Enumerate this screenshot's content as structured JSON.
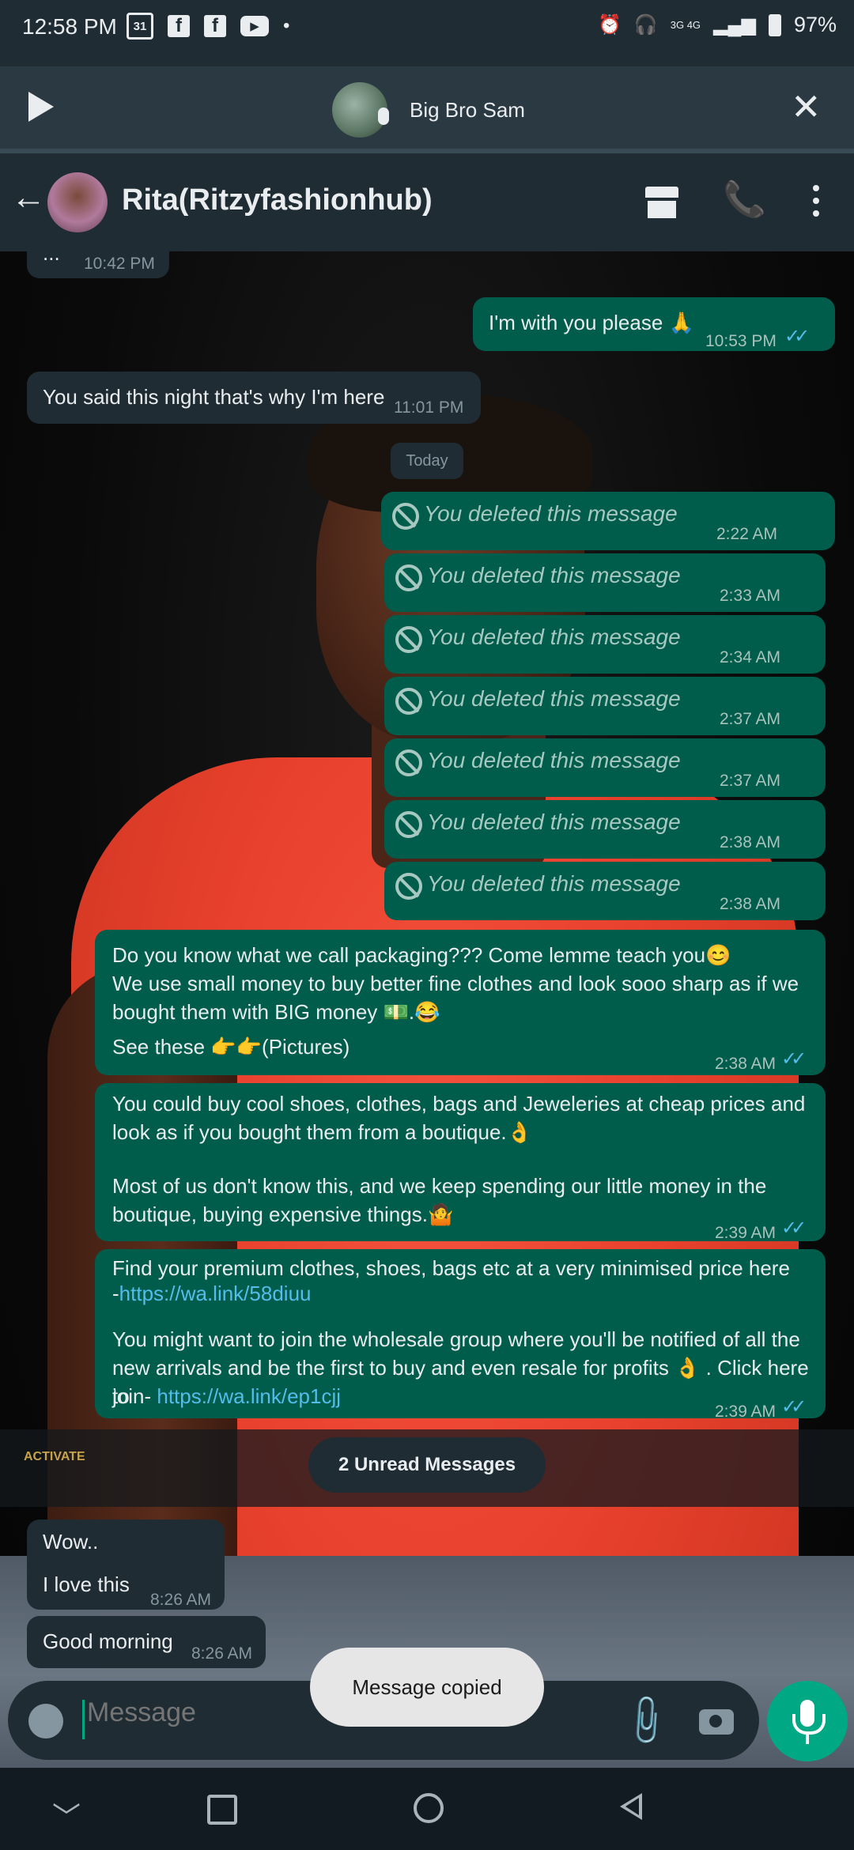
{
  "status_bar": {
    "time": "12:58 PM",
    "calendar_badge": "31",
    "network_label": "3G 4G",
    "battery": "97%"
  },
  "voice_chat": {
    "participant": "Big Bro Sam"
  },
  "header": {
    "contact_name": "Rita(Ritzyfashionhub)"
  },
  "messages": {
    "m0": {
      "text": "...",
      "time": "10:42 PM"
    },
    "m1": {
      "text": "I'm with you please 🙏",
      "time": "10:53 PM"
    },
    "m2": {
      "text": "You said this night that's why I'm here",
      "time": "11:01 PM"
    },
    "date_chip": "Today",
    "deleted_text": "You deleted this message",
    "deleted_times": [
      "2:22 AM",
      "2:33 AM",
      "2:34 AM",
      "2:37 AM",
      "2:37 AM",
      "2:38 AM",
      "2:38 AM"
    ],
    "m3": {
      "line1": "Do you know what we call packaging??? Come lemme teach you😊",
      "line2": "We use small money to buy better fine clothes and look sooo sharp as if we",
      "line3": "bought them with BIG money 💵.😂",
      "line4": "See these 👉👉(Pictures)",
      "time": "2:38 AM"
    },
    "m4": {
      "line1": "You could buy cool shoes, clothes, bags and Jeweleries at cheap prices and",
      "line2": "look as if you bought them from a boutique.👌",
      "line3": "Most of us don't know this, and we keep spending our little money in the",
      "line4": "boutique, buying expensive things.🤷",
      "time": "2:39 AM"
    },
    "m5": {
      "line1": "Find your premium clothes, shoes, bags etc at a very minimised price here",
      "line2_prefix": "-",
      "link1": "https://wa.link/58diuu",
      "line3": "You might want to join the wholesale group where you'll be notified of all the",
      "line4": "new arrivals and be the first to buy and even resale for profits 👌 . Click here to",
      "line5_prefix": "join- ",
      "link2": "https://wa.link/ep1cjj",
      "time": "2:39 AM"
    },
    "unread": "2 Unread Messages",
    "watermark": "ACTIVATE",
    "m6": {
      "line1": "Wow..",
      "line2": "I love this",
      "time": "8:26 AM"
    },
    "m7": {
      "text": "Good morning",
      "time": "8:26 AM"
    }
  },
  "toast": "Message copied",
  "composer": {
    "placeholder": "Message"
  },
  "icons": {
    "read_receipt": "double-check-icon",
    "deleted": "blocked-icon"
  },
  "colors": {
    "outgoing_bubble": "#005c4b",
    "incoming_bubble": "#202c33",
    "accent": "#00a884",
    "link": "#53bdeb"
  }
}
